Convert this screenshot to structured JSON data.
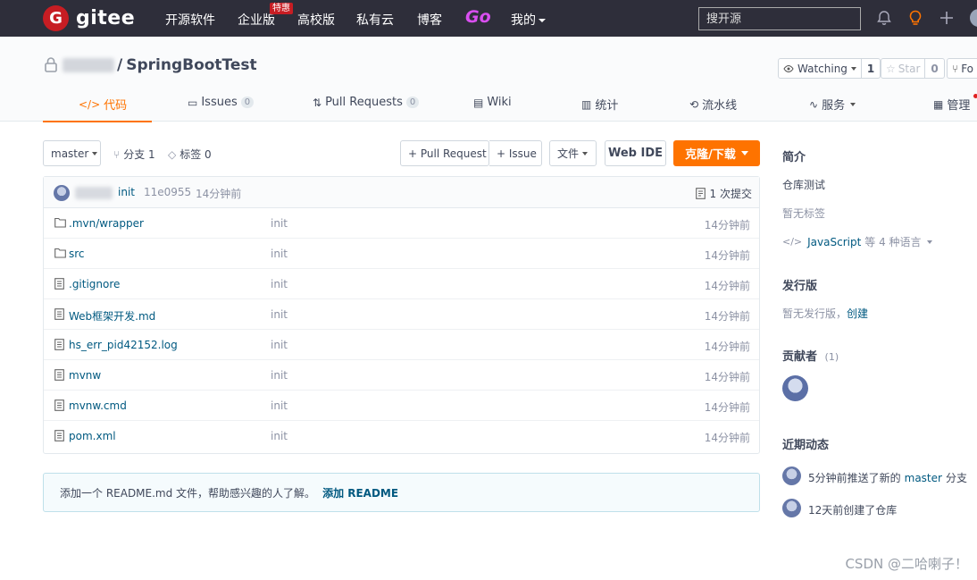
{
  "topnav": {
    "logo_letter": "G",
    "logo_text": "gitee",
    "items": [
      "开源软件",
      "企业版",
      "高校版",
      "私有云",
      "博客"
    ],
    "hot_badge": "特惠",
    "go": "Go",
    "mine": "我的",
    "search_placeholder": "搜开源"
  },
  "repo": {
    "name": "SpringBootTest",
    "slash": "/",
    "watching_label": "Watching",
    "watching_count": "1",
    "star_label": "Star",
    "star_count": "0",
    "fork_label": "Fo"
  },
  "tabs": [
    {
      "label": "代码",
      "icon": "</>"
    },
    {
      "label": "Issues",
      "count": "0"
    },
    {
      "label": "Pull Requests",
      "count": "0"
    },
    {
      "label": "Wiki"
    },
    {
      "label": "统计"
    },
    {
      "label": "流水线"
    },
    {
      "label": "服务"
    },
    {
      "label": "管理"
    }
  ],
  "toolbar": {
    "branch": "master",
    "branches": "分支 1",
    "tags": "标签 0",
    "pull_request": "+ Pull Request",
    "issue": "+ Issue",
    "file": "文件",
    "web_ide": "Web IDE",
    "clone": "克隆/下载"
  },
  "commit": {
    "message": "init",
    "hash": "11e0955",
    "time": "14分钟前",
    "count": "1 次提交"
  },
  "files": [
    {
      "name": ".mvn/wrapper",
      "type": "folder",
      "message": "init",
      "time": "14分钟前"
    },
    {
      "name": "src",
      "type": "folder",
      "message": "init",
      "time": "14分钟前"
    },
    {
      "name": ".gitignore",
      "type": "file",
      "message": "init",
      "time": "14分钟前"
    },
    {
      "name": "Web框架开发.md",
      "type": "file",
      "message": "init",
      "time": "14分钟前"
    },
    {
      "name": "hs_err_pid42152.log",
      "type": "file",
      "message": "init",
      "time": "14分钟前"
    },
    {
      "name": "mvnw",
      "type": "file",
      "message": "init",
      "time": "14分钟前"
    },
    {
      "name": "mvnw.cmd",
      "type": "file",
      "message": "init",
      "time": "14分钟前"
    },
    {
      "name": "pom.xml",
      "type": "file",
      "message": "init",
      "time": "14分钟前"
    }
  ],
  "readme": {
    "text": "添加一个 README.md 文件，帮助感兴趣的人了解。",
    "link": "添加 README"
  },
  "sidebar": {
    "intro_title": "简介",
    "intro_text": "仓库测试",
    "no_tags": "暂无标签",
    "lang_link": "JavaScript",
    "lang_rest": "等 4 种语言",
    "release_title": "发行版",
    "release_text": "暂无发行版，",
    "release_create": "创建",
    "contrib_title": "贡献者",
    "contrib_count": "(1)",
    "activity_title": "近期动态",
    "activity1_a": "5分钟前推送了新的",
    "activity1_branch": "master",
    "activity1_b": "分支",
    "activity2": "12天前创建了仓库"
  },
  "watermark": "CSDN @二哈喇子！",
  "colors": {
    "accent": "#fe7300",
    "link": "#005980",
    "brand_red": "#c71d23",
    "topbar": "#2e2e3a"
  }
}
